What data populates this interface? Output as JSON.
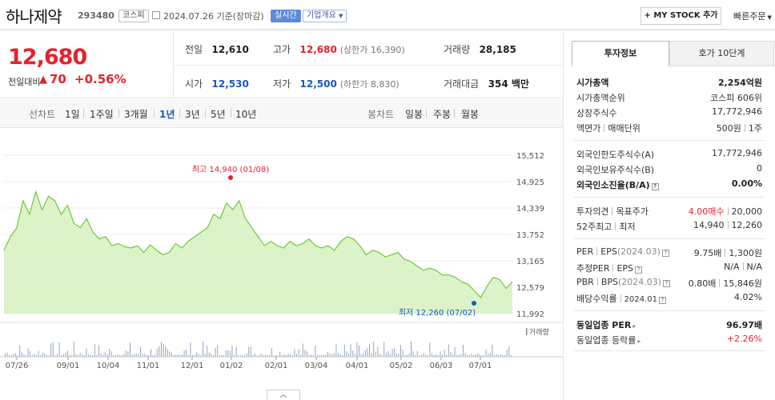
{
  "header": {
    "name": "하나제약",
    "code": "293480",
    "market": "코스피",
    "date_text": "2024.07.26 기준(장마감)",
    "realtime_label": "실시간",
    "company_label": "기업개요",
    "mystock_label": "+ MY STOCK 추가",
    "quick_order_label": "빠른주문"
  },
  "quote": {
    "price": "12,680",
    "change_label": "전일대비",
    "change_arrow": "▲",
    "change_value": "70",
    "change_pct": "+0.56%",
    "prev_label": "전일",
    "prev_value": "12,610",
    "high_label": "고가",
    "high_value": "12,680",
    "upper_limit": "(상한가 16,390)",
    "volume_label": "거래량",
    "volume_value": "28,185",
    "open_label": "시가",
    "open_value": "12,530",
    "low_label": "저가",
    "low_value": "12,500",
    "lower_limit": "(하한가 8,830)",
    "amount_label": "거래대금",
    "amount_value": "354 백만"
  },
  "tabs": {
    "line_label": "선차트",
    "periods": [
      "1일",
      "1주일",
      "3개월",
      "1년",
      "3년",
      "5년",
      "10년"
    ],
    "active_period": "1년",
    "candle_label": "봉차트",
    "candle_periods": [
      "일봉",
      "주봉",
      "월봉"
    ]
  },
  "chart_data": {
    "type": "area",
    "color": "#6fc93a",
    "fill": "#d8f2c4",
    "y_ticks": [
      "15,512",
      "14,925",
      "14,339",
      "13,752",
      "13,165",
      "12,579",
      "11,992"
    ],
    "ylim": [
      11992,
      15512
    ],
    "x_ticks": [
      "07/26",
      "09/01",
      "10/04",
      "11/01",
      "12/01",
      "01/02",
      "02/01",
      "03/04",
      "04/01",
      "05/02",
      "06/03",
      "07/01"
    ],
    "high_annotation": "최고 14,940 (01/08)",
    "low_annotation": "최저 12,260 (07/02)",
    "high_value": 14940,
    "low_value": 12260,
    "volume_label": "거래량",
    "grid": true
  },
  "collapse_icon": "chevron-up-icon",
  "info_panel": {
    "tab_invest": "투자정보",
    "tab_orderbook": "호가 10단계",
    "market_cap_label": "시가총액",
    "market_cap_value": "2,254억원",
    "rank_label": "시가총액순위",
    "rank_value": "코스피 606위",
    "shares_label": "상장주식수",
    "shares_value": "17,772,946",
    "par_label": "액면가",
    "unit_label": "매매단위",
    "par_value": "500원",
    "unit_value": "1주",
    "foreign_limit_label": "외국인한도주식수(A)",
    "foreign_limit_value": "17,772,946",
    "foreign_hold_label": "외국인보유주식수(B)",
    "foreign_hold_value": "0",
    "foreign_ratio_label": "외국인소진율(B/A)",
    "foreign_ratio_value": "0.00%",
    "opinion_label": "투자의견",
    "target_label": "목표주가",
    "opinion_value": "4.00매수",
    "target_value": "20,000",
    "w52_label": "52주최고",
    "w52_low_label": "최저",
    "w52_high_value": "14,940",
    "w52_low_value": "12,260",
    "per_label": "PER",
    "eps_label": "EPS",
    "eps_period": "(2024.03)",
    "per_value": "9.75배",
    "eps_value": "1,300원",
    "est_per_label": "추정PER",
    "est_eps_label": "EPS",
    "est_per_value": "N/A",
    "est_eps_value": "N/A",
    "pbr_label": "PBR",
    "bps_label": "BPS",
    "bps_period": "(2024.03)",
    "pbr_value": "0.80배",
    "bps_value": "15,846원",
    "dividend_label": "배당수익률",
    "dividend_period": "2024.01",
    "dividend_value": "4.02%",
    "sector_per_label": "동일업종 PER",
    "sector_per_value": "96.97배",
    "sector_rate_label": "동일업종 등락률",
    "sector_rate_value": "+2.26%"
  }
}
